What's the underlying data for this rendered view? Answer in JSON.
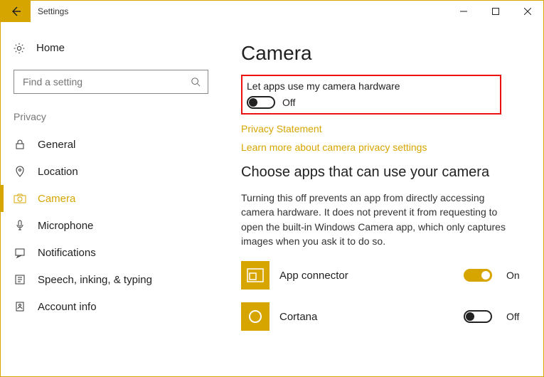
{
  "window": {
    "title": "Settings"
  },
  "sidebar": {
    "home_label": "Home",
    "search_placeholder": "Find a setting",
    "section_label": "Privacy",
    "items": [
      {
        "label": "General"
      },
      {
        "label": "Location"
      },
      {
        "label": "Camera"
      },
      {
        "label": "Microphone"
      },
      {
        "label": "Notifications"
      },
      {
        "label": "Speech, inking, & typing"
      },
      {
        "label": "Account info"
      }
    ]
  },
  "main": {
    "title": "Camera",
    "toggle_label": "Let apps use my camera hardware",
    "toggle_state": "Off",
    "link_privacy": "Privacy Statement",
    "link_learn": "Learn more about camera privacy settings",
    "subhead": "Choose apps that can use your camera",
    "desc": "Turning this off prevents an app from directly accessing camera hardware. It does not prevent it from requesting to open the built-in Windows Camera app, which only captures images when you ask it to do so.",
    "apps": [
      {
        "name": "App connector",
        "state": "On"
      },
      {
        "name": "Cortana",
        "state": "Off"
      }
    ]
  }
}
